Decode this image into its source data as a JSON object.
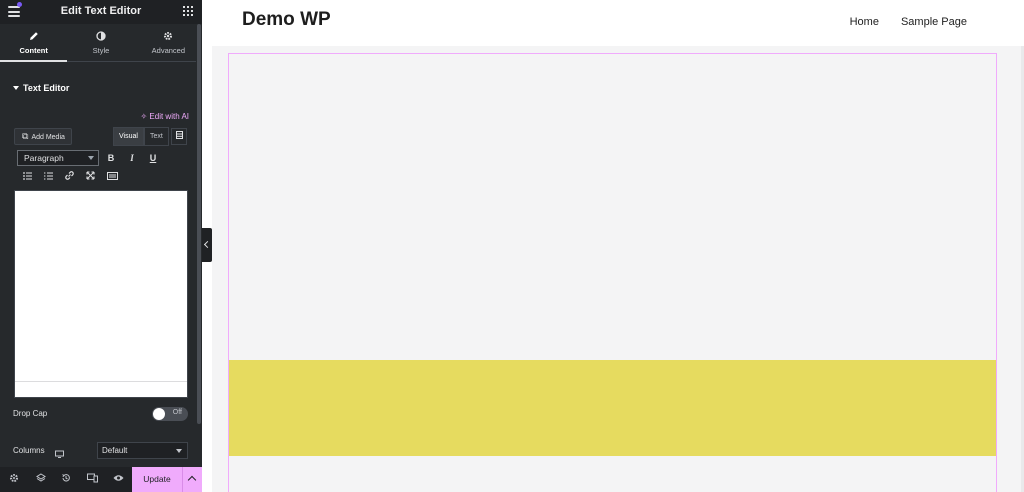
{
  "panel": {
    "title": "Edit Text Editor",
    "tabs": [
      {
        "label": "Content",
        "icon": "pencil-icon",
        "active": true
      },
      {
        "label": "Style",
        "icon": "half-circle-icon",
        "active": false
      },
      {
        "label": "Advanced",
        "icon": "gear-icon",
        "active": false
      }
    ],
    "section_title": "Text Editor",
    "edit_with_ai": "Edit with AI",
    "add_media": "Add Media",
    "mode_tabs": [
      "Visual",
      "Text"
    ],
    "format_select": "Paragraph",
    "toolbar_bold": "B",
    "toolbar_italic": "I",
    "toolbar_underline": "U",
    "drop_cap_label": "Drop Cap",
    "drop_cap_state": "Off",
    "columns_label": "Columns",
    "columns_value": "Default",
    "update_label": "Update"
  },
  "site": {
    "title": "Demo WP",
    "nav": [
      "Home",
      "Sample Page"
    ]
  },
  "colors": {
    "panel_bg": "#26292c",
    "accent_pink": "#f0abfc",
    "band_yellow": "#e6db5f",
    "canvas_bg": "#f4f4f5"
  }
}
